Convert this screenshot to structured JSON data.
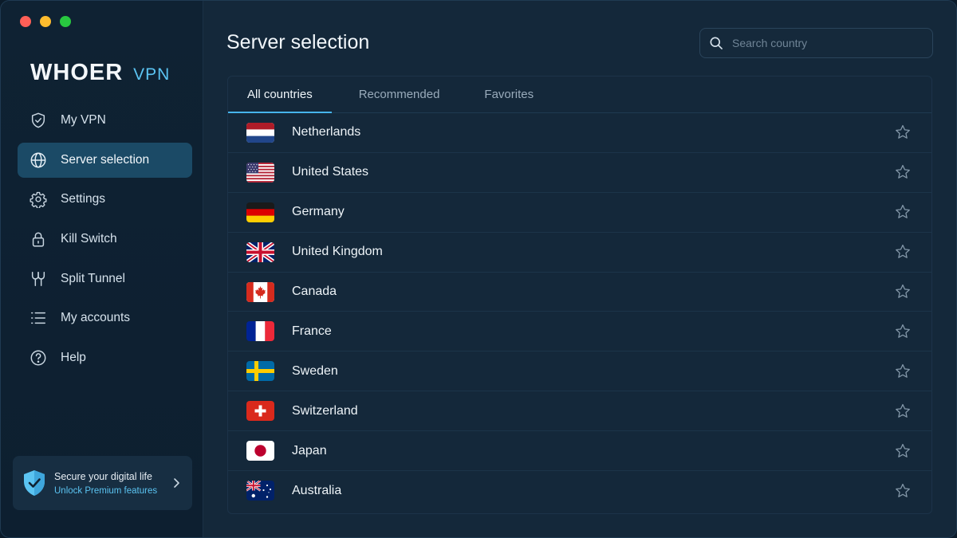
{
  "app": {
    "brand_name": "WHOER",
    "brand_sub": "VPN"
  },
  "sidebar": {
    "items": [
      {
        "label": "My VPN",
        "icon": "shield-check-icon"
      },
      {
        "label": "Server selection",
        "icon": "globe-icon",
        "active": true
      },
      {
        "label": "Settings",
        "icon": "gear-icon"
      },
      {
        "label": "Kill Switch",
        "icon": "lock-icon"
      },
      {
        "label": "Split Tunnel",
        "icon": "split-tunnel-icon"
      },
      {
        "label": "My accounts",
        "icon": "list-icon"
      },
      {
        "label": "Help",
        "icon": "help-circle-icon"
      }
    ],
    "promo": {
      "title": "Secure your digital life",
      "subtitle": "Unlock Premium features"
    }
  },
  "main": {
    "title": "Server selection",
    "search": {
      "placeholder": "Search country",
      "value": ""
    },
    "tabs": [
      {
        "label": "All countries",
        "active": true
      },
      {
        "label": "Recommended"
      },
      {
        "label": "Favorites"
      }
    ],
    "countries": [
      {
        "name": "Netherlands",
        "flag": "nl"
      },
      {
        "name": "United States",
        "flag": "us"
      },
      {
        "name": "Germany",
        "flag": "de"
      },
      {
        "name": "United Kingdom",
        "flag": "gb"
      },
      {
        "name": "Canada",
        "flag": "ca"
      },
      {
        "name": "France",
        "flag": "fr"
      },
      {
        "name": "Sweden",
        "flag": "se"
      },
      {
        "name": "Switzerland",
        "flag": "ch"
      },
      {
        "name": "Japan",
        "flag": "jp"
      },
      {
        "name": "Australia",
        "flag": "au"
      }
    ]
  },
  "colors": {
    "accent": "#5bc4f2",
    "active_nav": "#1b4a66",
    "background": "#14283a",
    "sidebar": "#0f2233"
  }
}
